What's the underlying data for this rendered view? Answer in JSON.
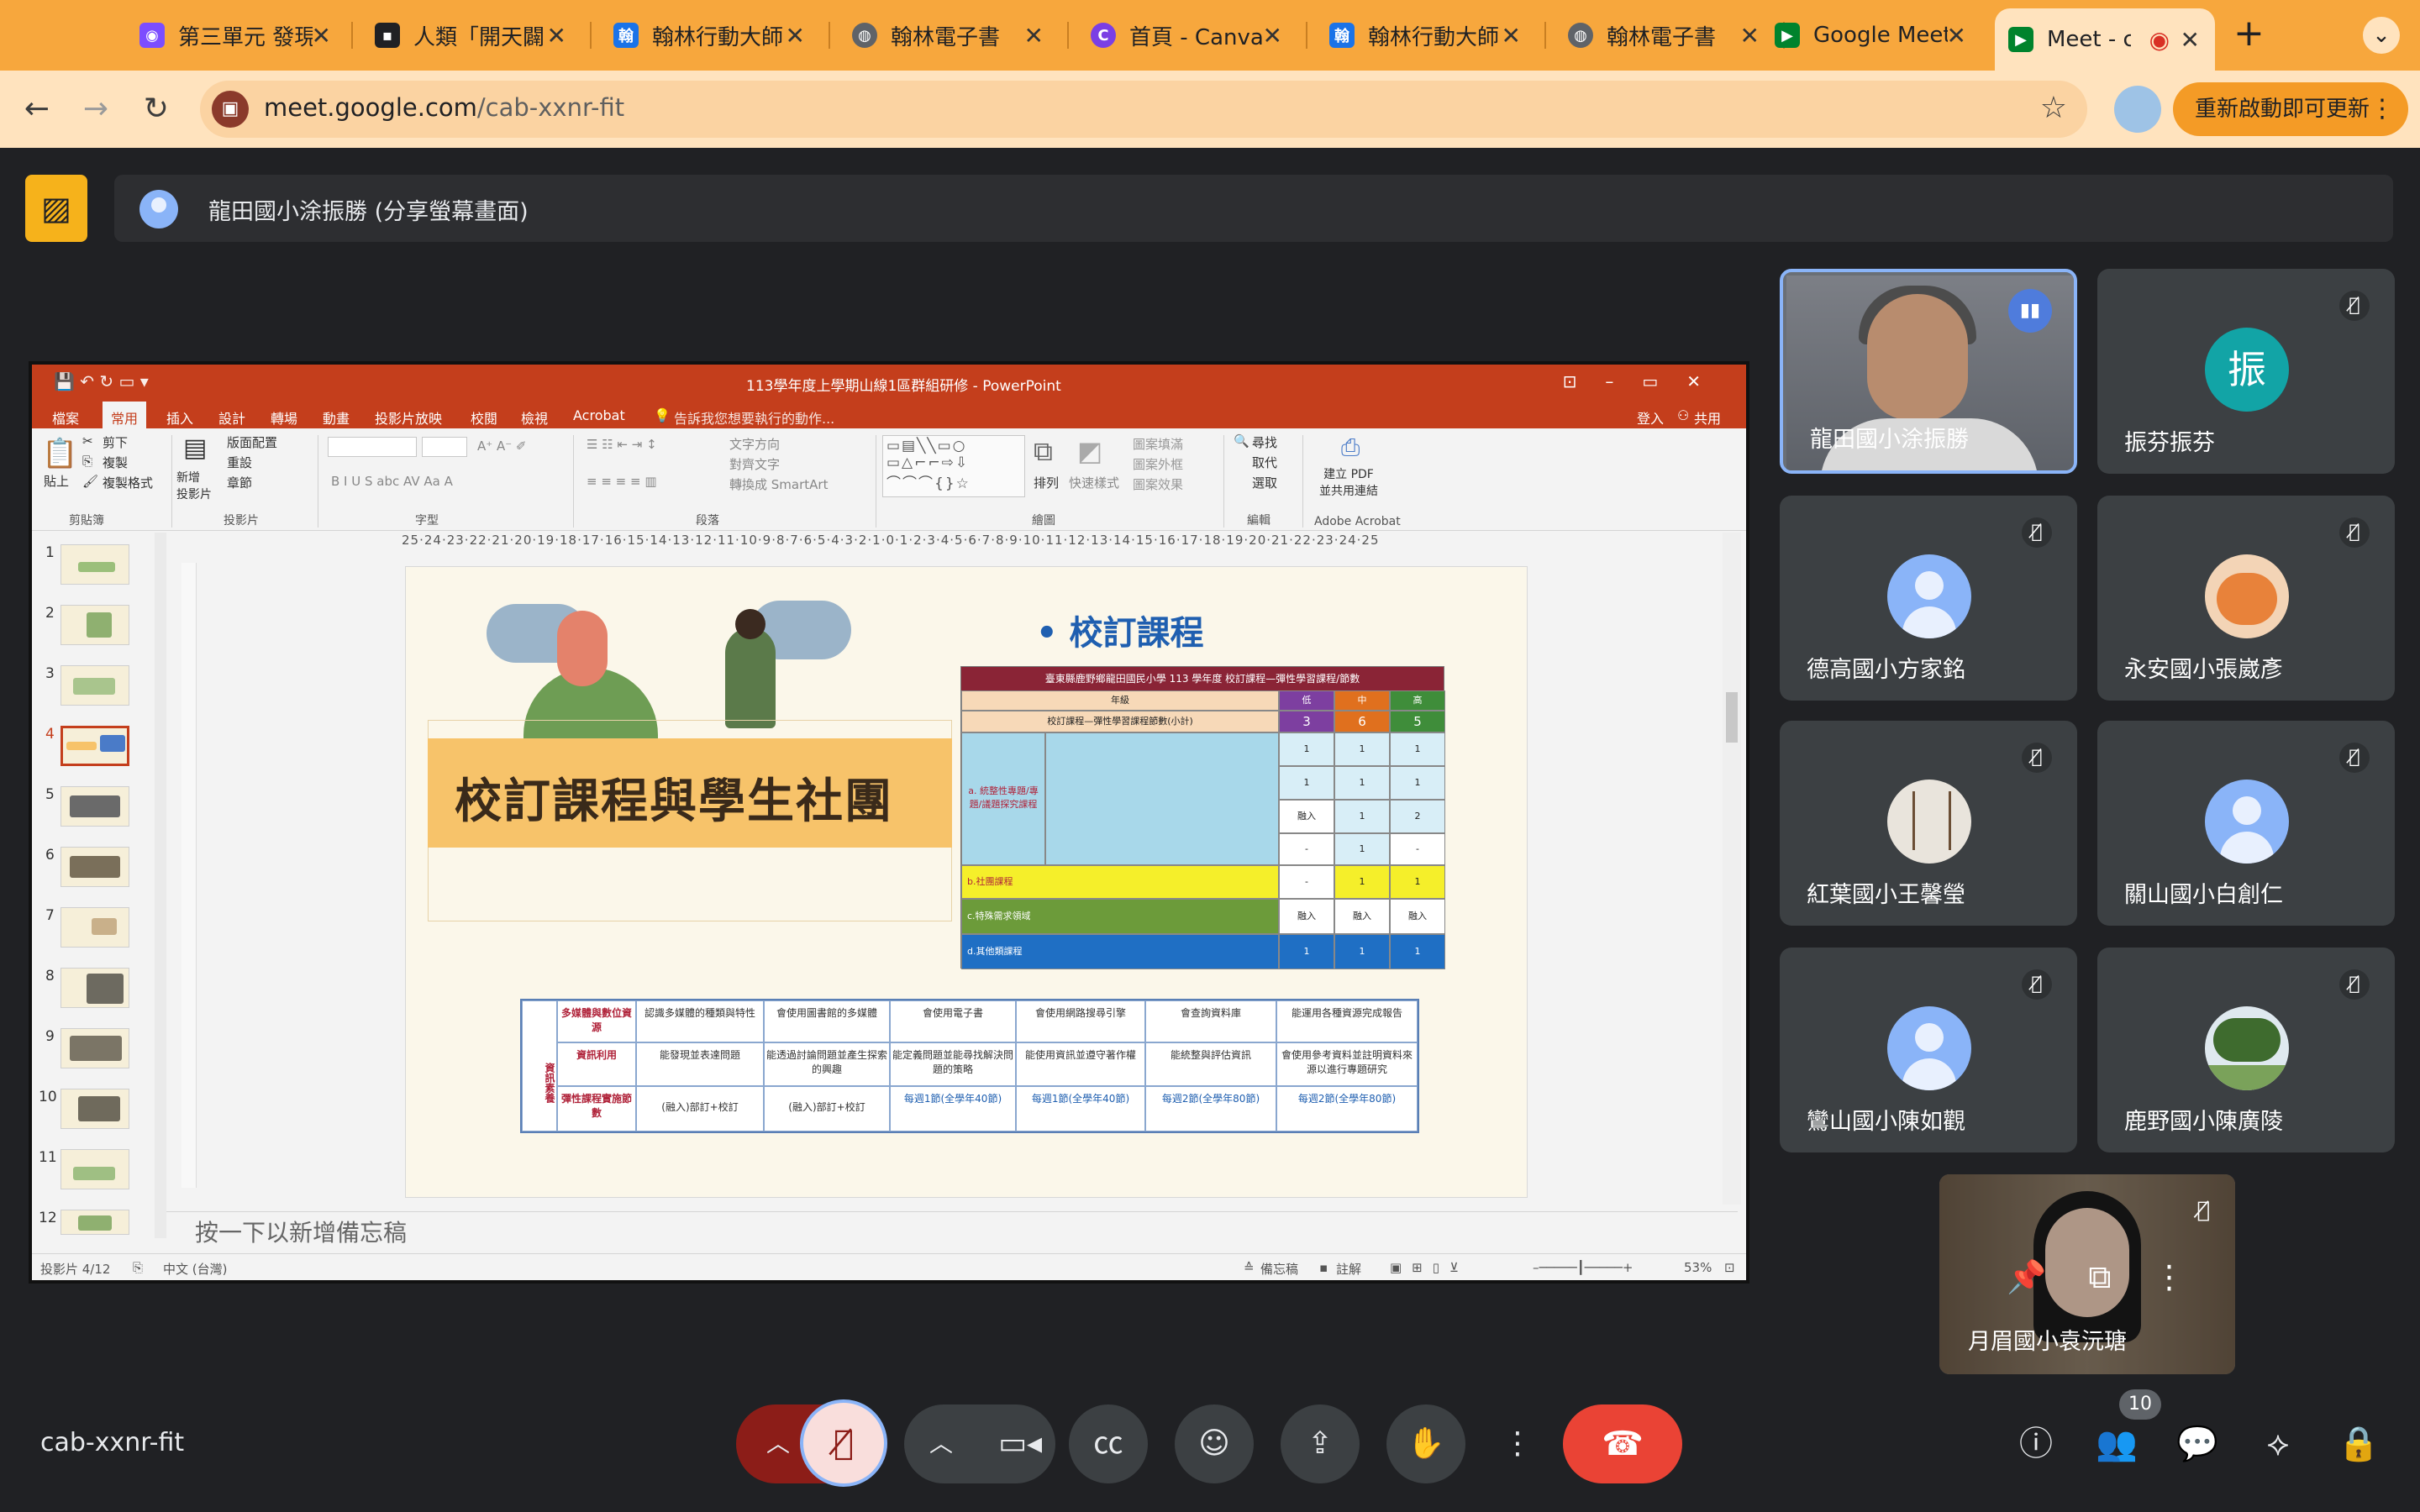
{
  "browser": {
    "tabs": [
      {
        "title": "第三單元 發現",
        "favicon_color": "#7c4dff"
      },
      {
        "title": "人類「開天闢",
        "favicon_color": "#202124"
      },
      {
        "title": "翰林行動大師",
        "favicon_color": "#1a73e8"
      },
      {
        "title": "翰林電子書",
        "favicon_color": "#5f6368"
      },
      {
        "title": "首頁 - Canva",
        "favicon_color": "#7b3fe4"
      },
      {
        "title": "翰林行動大師",
        "favicon_color": "#1a73e8"
      },
      {
        "title": "翰林電子書",
        "favicon_color": "#5f6368"
      },
      {
        "title": "Google Meet",
        "favicon_color": "#00832d"
      },
      {
        "title": "Meet - c",
        "favicon_color": "#00832d"
      }
    ],
    "new_tab": "+",
    "url_host": "meet.google.com",
    "url_path": "/cab-xxnr-fit",
    "update_button": "重新啟動即可更新"
  },
  "presentation": {
    "presenter_label": "龍田國小涂振勝 (分享螢幕畫面)"
  },
  "ppt": {
    "window_title": "113學年度上學期山線1區群組研修 - PowerPoint",
    "menu": [
      "檔案",
      "常用",
      "插入",
      "設計",
      "轉場",
      "動畫",
      "投影片放映",
      "校閱",
      "檢視",
      "Acrobat"
    ],
    "tell_me": "告訴我您想要執行的動作...",
    "sign_in": "登入",
    "share": "共用",
    "ribbon": {
      "cut": "剪下",
      "copy": "複製",
      "format_painter": "複製格式",
      "paste": "貼上",
      "new_slide": "新增\n投影片",
      "layout": "版面配置",
      "reset": "重設",
      "section": "章節",
      "text_direction": "文字方向",
      "align_text": "對齊文字",
      "smartart": "轉換成 SmartArt",
      "arrange": "排列",
      "quick_styles": "快速樣式",
      "shape_fill": "圖案填滿",
      "shape_outline": "圖案外框",
      "shape_effects": "圖案效果",
      "find": "尋找",
      "replace": "取代",
      "select": "選取",
      "create_pdf": "建立 PDF\n並共用連結",
      "groups": [
        "剪貼簿",
        "投影片",
        "字型",
        "段落",
        "繪圖",
        "編輯",
        "Adobe Acrobat"
      ]
    },
    "ruler": "25·24·23·22·21·20·19·18·17·16·15·14·13·12·11·10·9·8·7·6·5·4·3·2·1·0·1·2·3·4·5·6·7·8·9·10·11·12·13·14·15·16·17·18·19·20·21·22·23·24·25",
    "thumbnails": [
      "1",
      "2",
      "3",
      "4",
      "5",
      "6",
      "7",
      "8",
      "9",
      "10",
      "11",
      "12"
    ],
    "selected_slide": 4,
    "slide": {
      "banner": "校訂課程與學生社團",
      "heading": "• 校訂課程",
      "top_table": {
        "header": "臺東縣鹿野鄉龍田國民小學 113 學年度 校訂課程—彈性學習課程/節數",
        "grade_label": "年級",
        "grades": [
          "低",
          "中",
          "高"
        ],
        "total_label": "校訂課程—彈性學習課程節數(小計)",
        "totals": [
          "3",
          "6",
          "5"
        ],
        "section_a": "a. 統整性專題/專題/議題探究課程",
        "rows_a": [
          [
            "1",
            "1",
            "1"
          ],
          [
            "1",
            "1",
            "1"
          ],
          [
            "融入",
            "1",
            "2"
          ],
          [
            "-",
            "1",
            "-"
          ]
        ],
        "section_b": "b.社團課程",
        "rows_b": [
          "-",
          "1",
          "1"
        ],
        "section_c": "c.特殊需求領域",
        "rows_c": [
          "融入",
          "融入",
          "融入"
        ],
        "section_d": "d.其他類課程",
        "rows_d": [
          "1",
          "1",
          "1"
        ]
      },
      "bottom_table": {
        "side": "資訊素養",
        "rows": [
          [
            "多媒體與數位資源",
            "認識多媒體的種類與特性",
            "會使用圖書館的多媒體",
            "會使用電子書",
            "會使用網路搜尋引擎",
            "會查詢資料庫",
            "能運用各種資源完成報告"
          ],
          [
            "資訊利用",
            "能發現並表達問題",
            "能透過討論問題並產生探索的興趣",
            "能定義問題並能尋找解決問題的策略",
            "能使用資訊並遵守著作權",
            "能統整與評估資訊",
            "會使用參考資料並註明資料來源以進行專題研究"
          ],
          [
            "彈性課程實施節數",
            "(融入)部訂+校訂",
            "(融入)部訂+校訂",
            "每週1節(全學年40節)",
            "每週1節(全學年40節)",
            "每週2節(全學年80節)",
            "每週2節(全學年80節)"
          ]
        ]
      }
    },
    "notes_placeholder": "按一下以新增備忘稿",
    "status": {
      "slide_of": "投影片 4/12",
      "language": "中文 (台灣)",
      "notes": "備忘稿",
      "comments": "註解",
      "zoom": "53%"
    }
  },
  "participants": [
    {
      "name": "龍田國小涂振勝",
      "speaking": true
    },
    {
      "name": "振芬振芬",
      "avatar_letter": "振",
      "muted": true
    },
    {
      "name": "德高國小方家銘",
      "muted": true
    },
    {
      "name": "永安國小張崴彥",
      "muted": true
    },
    {
      "name": "紅葉國小王馨瑩",
      "muted": true
    },
    {
      "name": "關山國小白創仁",
      "muted": true
    },
    {
      "name": "鸞山國小陳如觀",
      "muted": true
    },
    {
      "name": "鹿野國小陳廣陵",
      "muted": true
    }
  ],
  "self_view": {
    "name": "月眉國小袁沅瑭"
  },
  "controls": {
    "meeting_code": "cab-xxnr-fit",
    "participant_count": "10"
  },
  "colors": {
    "tabstrip": "#f7a73d",
    "toolbar": "#ffe3be",
    "meet_bg": "#202124",
    "ppt_red": "#c43e1c",
    "end_call": "#ea4335",
    "speaking_border": "#8ab4f8"
  }
}
